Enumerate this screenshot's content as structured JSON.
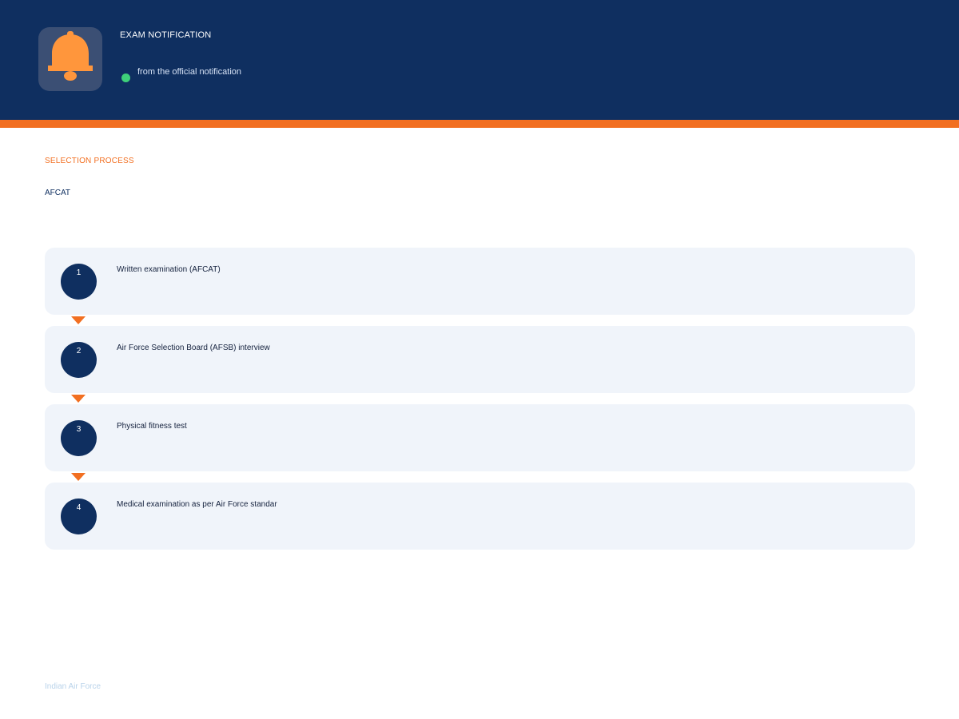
{
  "header": {
    "title": "EXAM NOTIFICATION",
    "subtitle": "from the official notification",
    "icon": "bell-icon"
  },
  "section": {
    "label": "SELECTION PROCESS",
    "exam": "AFCAT"
  },
  "steps": [
    {
      "number": "1",
      "text": "Written examination (AFCAT)"
    },
    {
      "number": "2",
      "text": "Air Force Selection Board (AFSB) interview"
    },
    {
      "number": "3",
      "text": "Physical fitness test"
    },
    {
      "number": "4",
      "text": "Medical examination as per Air Force standar"
    }
  ],
  "footer": {
    "text": "Indian Air Force"
  },
  "colors": {
    "navy": "#0f2f60",
    "orange": "#f26f21",
    "bell": "#ff963c",
    "status_green": "#3ed17a",
    "card_bg": "#f0f4fa"
  }
}
